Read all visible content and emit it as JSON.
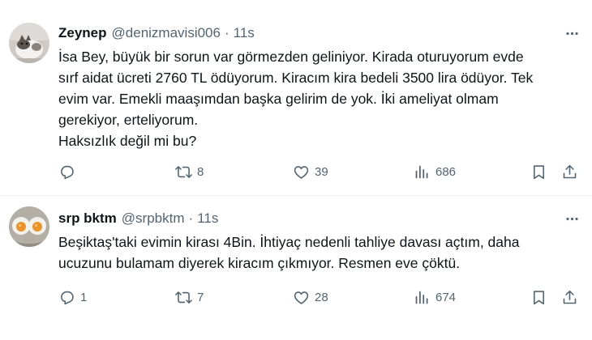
{
  "tweets": [
    {
      "author": {
        "name": "Zeynep",
        "handle": "@denizmavisi006",
        "avatar": "cat-avatar"
      },
      "separator": "·",
      "time": "11s",
      "text_lines": [
        "İsa Bey, büyük bir sorun var görmezden geliniyor. Kirada oturuyorum evde",
        "sırf aidat ücreti 2760 TL ödüyorum. Kiracım kira bedeli 3500 lira ödüyor. Tek",
        "evim var. Emekli maaşımdan başka gelirim de yok. İki ameliyat olmam",
        "gerekiyor, erteliyorum.",
        "Haksızlık değil mi bu?"
      ],
      "stats": {
        "replies": "",
        "retweets": "8",
        "likes": "39",
        "views": "686"
      }
    },
    {
      "author": {
        "name": "srp bktm",
        "handle": "@srpbktm",
        "avatar": "eggs-avatar"
      },
      "separator": "·",
      "time": "11s",
      "text_lines": [
        "Beşiktaş'taki evimin kirası 4Bin. İhtiyaç nedenli tahliye davası açtım, daha",
        "ucuzunu bulamam diyerek kiracım çıkmıyor. Resmen eve çöktü."
      ],
      "stats": {
        "replies": "1",
        "retweets": "7",
        "likes": "28",
        "views": "674"
      }
    }
  ],
  "icons": {
    "reply": "reply-icon",
    "retweet": "retweet-icon",
    "like": "heart-icon",
    "views": "views-icon",
    "bookmark": "bookmark-icon",
    "share": "share-icon",
    "more": "more-icon"
  },
  "colors": {
    "text": "#0f1419",
    "secondary": "#536471",
    "divider": "#eff3f4"
  }
}
